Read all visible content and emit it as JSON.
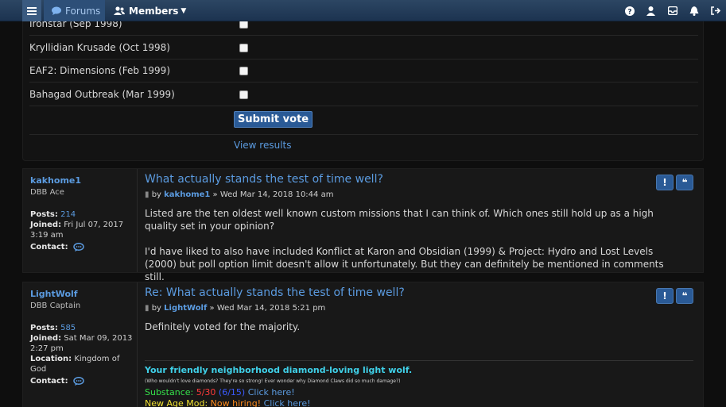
{
  "nav": {
    "forums_label": "Forums",
    "members_label": "Members",
    "right_icons": [
      "help-icon",
      "user-icon",
      "inbox-icon",
      "bell-icon",
      "logout-icon"
    ]
  },
  "poll": {
    "options": [
      "Ironstar (Sep 1998)",
      "Kryllidian Krusade (Oct 1998)",
      "EAF2: Dimensions (Feb 1999)",
      "Bahagad Outbreak (Mar 1999)"
    ],
    "submit_label": "Submit vote",
    "view_results_label": "View results"
  },
  "posts": [
    {
      "username": "kakhome1",
      "rank": "DBB Ace",
      "posts_label": "Posts:",
      "posts_value": "214",
      "joined_label": "Joined:",
      "joined_value": "Fri Jul 07, 2017 3:19 am",
      "contact_label": "Contact:",
      "title": "What actually stands the test of time well?",
      "by": "by",
      "author": "kakhome1",
      "date": "» Wed Mar 14, 2018 10:44 am",
      "paragraphs": [
        "Listed are the ten oldest well known custom missions that I can think of. Which ones still hold up as a high quality set in your opinion?",
        "I'd have liked to also have included Konflict at Karon and Obsidian (1999) & Project: Hydro and Lost Levels (2000) but poll option limit doesn't allow it unfortunately. But they can definitely be mentioned in comments still."
      ]
    },
    {
      "username": "LightWolf",
      "rank": "DBB Captain",
      "posts_label": "Posts:",
      "posts_value": "585",
      "joined_label": "Joined:",
      "joined_value": "Sat Mar 09, 2013 2:27 pm",
      "location_label": "Location:",
      "location_value": "Kingdom of God",
      "contact_label": "Contact:",
      "title": "Re: What actually stands the test of time well?",
      "by": "by",
      "author": "LightWolf",
      "date": "» Wed Mar 14, 2018 5:21 pm",
      "paragraphs": [
        "Definitely voted for the majority."
      ],
      "signature": {
        "line1": "Your friendly neighborhood diamond-loving light wolf.",
        "line2": "(Who wouldn't love diamonds? They're so strong! Ever wonder why Diamond Claws did so much damage?)",
        "substance_label": "Substance:",
        "substance_value": "5/30",
        "substance_extra": "(6/15)",
        "substance_link": "Click here!",
        "newage_label": "New Age Mod:",
        "newage_value": "Now hiring!",
        "newage_link": "Click here!"
      }
    }
  ]
}
